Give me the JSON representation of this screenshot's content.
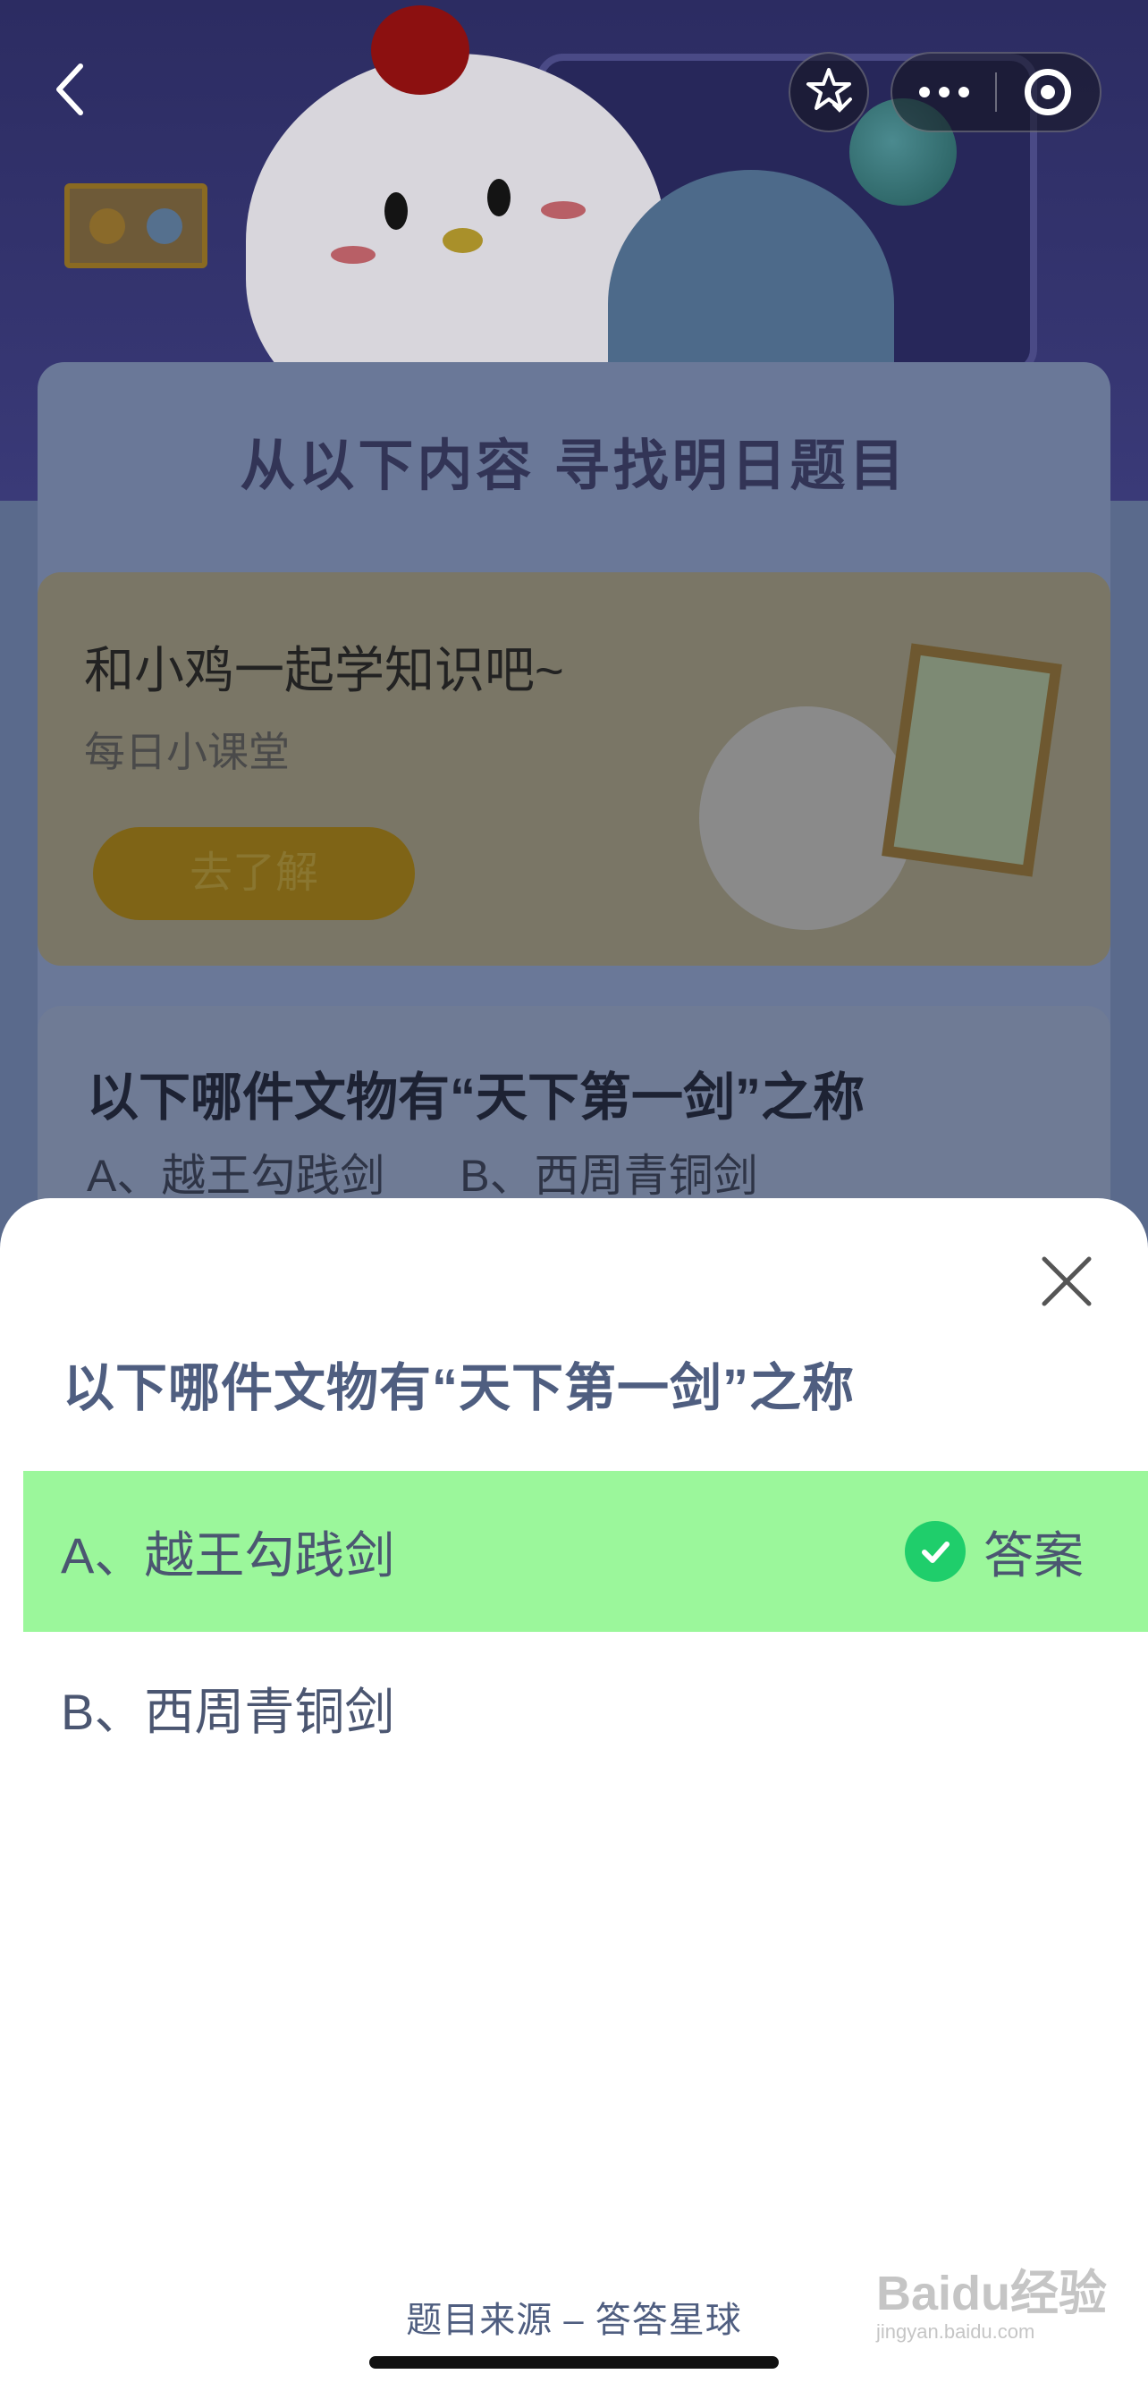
{
  "banner": {
    "title": "从以下内容 寻找明日题目"
  },
  "promo": {
    "title": "和小鸡一起学知识吧~",
    "subtitle": "每日小课堂",
    "button_label": "去了解"
  },
  "background_quiz": {
    "question": "以下哪件文物有“天下第一剑”之称",
    "options": [
      "A、越王勾践剑",
      "B、西周青铜剑"
    ]
  },
  "sheet": {
    "question": "以下哪件文物有“天下第一剑”之称",
    "options": [
      {
        "label": "A、越王勾践剑",
        "is_answer": true
      },
      {
        "label": "B、西周青铜剑",
        "is_answer": false
      }
    ],
    "answer_tag": "答案",
    "source": "题目来源 – 答答星球"
  },
  "watermark": {
    "logo": "Baidu经验",
    "url": "jingyan.baidu.com"
  },
  "colors": {
    "correct_bg": "#9bf79b",
    "check_green": "#1fce6b",
    "question_text": "#4f5e80"
  },
  "icons": [
    "chevron-left-icon",
    "star-check-icon",
    "more-dots-icon",
    "target-icon",
    "close-icon",
    "check-icon"
  ]
}
